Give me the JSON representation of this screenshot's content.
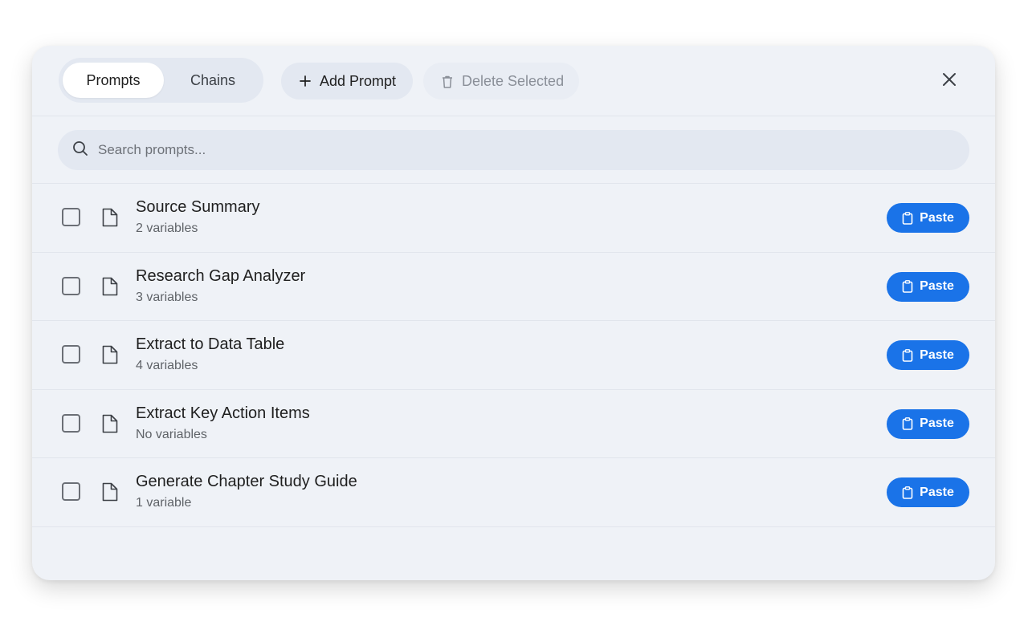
{
  "tabs": {
    "prompts_label": "Prompts",
    "chains_label": "Chains",
    "active": "Prompts"
  },
  "toolbar": {
    "add_label": "Add Prompt",
    "delete_label": "Delete Selected"
  },
  "search": {
    "placeholder": "Search prompts...",
    "value": ""
  },
  "items": [
    {
      "title": "Source Summary",
      "subtitle": "2 variables",
      "action": "Paste"
    },
    {
      "title": "Research Gap Analyzer",
      "subtitle": "3 variables",
      "action": "Paste"
    },
    {
      "title": "Extract to Data Table",
      "subtitle": "4 variables",
      "action": "Paste"
    },
    {
      "title": "Extract Key Action Items",
      "subtitle": "No variables",
      "action": "Paste"
    },
    {
      "title": "Generate Chapter Study Guide",
      "subtitle": "1 variable",
      "action": "Paste"
    }
  ],
  "icons": {
    "add": "plus-icon",
    "delete": "trash-icon",
    "close": "close-icon",
    "search": "search-icon",
    "item": "document-icon",
    "paste": "clipboard-icon"
  },
  "colors": {
    "accent": "#1a73e8",
    "modal_bg": "#eff2f7",
    "chip_bg": "#e3e8f1"
  }
}
